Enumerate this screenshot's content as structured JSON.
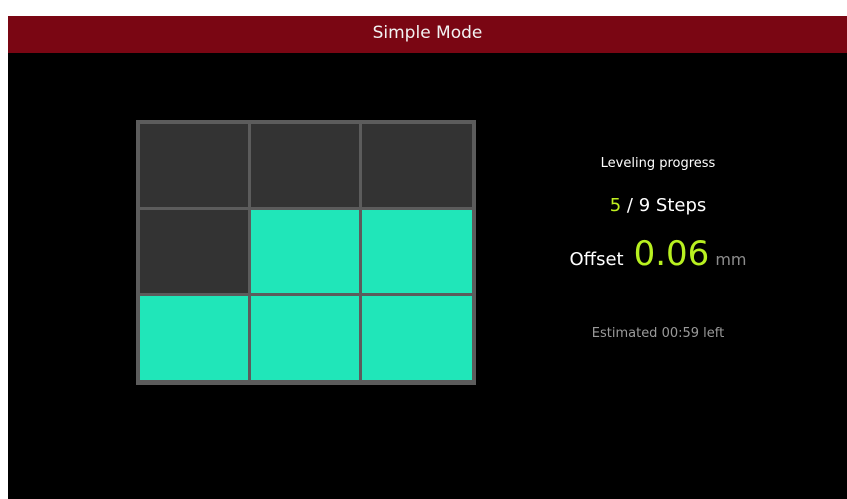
{
  "header": {
    "title": "Simple Mode"
  },
  "grid": {
    "rows": 3,
    "columns": 3,
    "cells": [
      false,
      false,
      false,
      false,
      true,
      true,
      true,
      true,
      true
    ]
  },
  "status": {
    "progress_label": "Leveling progress",
    "steps_current": "5",
    "steps_separator": "/",
    "steps_total": "9",
    "steps_unit": "Steps",
    "offset_label": "Offset",
    "offset_value": "0.06",
    "offset_unit": "mm",
    "estimate": "Estimated 00:59 left"
  },
  "colors": {
    "title_bar": "#7a0613",
    "cell_done": "#20e6b9",
    "cell_pending": "#333333",
    "steps_highlight": "#c0f020",
    "offset_value": "#b8f020"
  }
}
